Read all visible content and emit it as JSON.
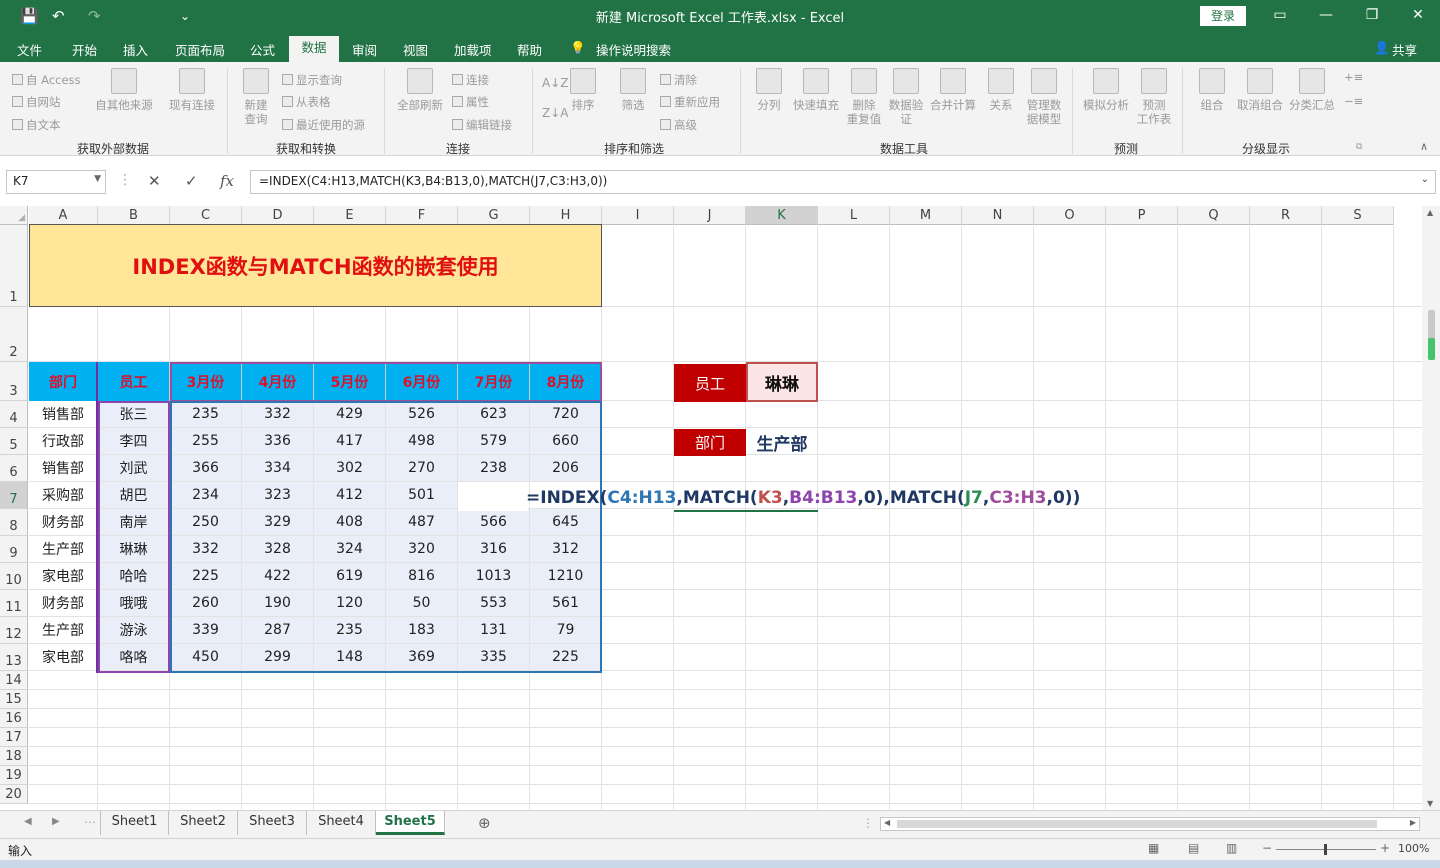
{
  "window": {
    "title": "新建 Microsoft Excel 工作表.xlsx  -  Excel",
    "login": "登录"
  },
  "qat": {
    "save": "💾",
    "undo": "↶",
    "redo": "↷",
    "more": "⌄"
  },
  "ribbon_tabs": [
    "文件",
    "开始",
    "插入",
    "页面布局",
    "公式",
    "数据",
    "审阅",
    "视图",
    "加载项",
    "帮助",
    "操作说明搜索"
  ],
  "share": "共享",
  "ribbon": {
    "ext": {
      "access": "自 Access",
      "web": "自网站",
      "text": "自文本",
      "other": "自其他来源",
      "existing": "现有连接",
      "group": "获取外部数据"
    },
    "transform": {
      "newq": "新建\n查询",
      "show": "显示查询",
      "table": "从表格",
      "recent": "最近使用的源",
      "group": "获取和转换"
    },
    "conn": {
      "refresh": "全部刷新",
      "connections": "连接",
      "props": "属性",
      "edit": "编辑链接",
      "group": "连接"
    },
    "sort": {
      "sort": "排序",
      "filter": "筛选",
      "clear": "清除",
      "reapply": "重新应用",
      "adv": "高级",
      "group": "排序和筛选"
    },
    "tools": {
      "split": "分列",
      "flash": "快速填充",
      "dup": "删除\n重复值",
      "valid": "数据验\n证",
      "cons": "合并计算",
      "rel": "关系",
      "model": "管理数\n据模型",
      "group": "数据工具"
    },
    "forecast": {
      "whatif": "模拟分析",
      "sheet": "预测\n工作表",
      "group": "预测"
    },
    "outline": {
      "grp": "组合",
      "ungrp": "取消组合",
      "sub": "分类汇总",
      "group": "分级显示"
    }
  },
  "namebox": "K7",
  "formula_bar": "=INDEX(C4:H13,MATCH(K3,B4:B13,0),MATCH(J7,C3:H3,0))",
  "columns": [
    "A",
    "B",
    "C",
    "D",
    "E",
    "F",
    "G",
    "H",
    "I",
    "J",
    "K",
    "L",
    "M",
    "N",
    "O",
    "P",
    "Q",
    "R",
    "S"
  ],
  "rows": [
    "1",
    "2",
    "3",
    "4",
    "5",
    "6",
    "7",
    "8",
    "9",
    "10",
    "11",
    "12",
    "13",
    "14",
    "15",
    "16",
    "17",
    "18",
    "19",
    "20"
  ],
  "sheet": {
    "title": "INDEX函数与MATCH函数的嵌套使用",
    "headers": [
      "部门",
      "员工",
      "3月份",
      "4月份",
      "5月份",
      "6月份",
      "7月份",
      "8月份"
    ],
    "data": [
      [
        "销售部",
        "张三",
        "235",
        "332",
        "429",
        "526",
        "623",
        "720"
      ],
      [
        "行政部",
        "李四",
        "255",
        "336",
        "417",
        "498",
        "579",
        "660"
      ],
      [
        "销售部",
        "刘武",
        "366",
        "334",
        "302",
        "270",
        "238",
        "206"
      ],
      [
        "采购部",
        "胡巴",
        "234",
        "323",
        "412",
        "501",
        "",
        ""
      ],
      [
        "财务部",
        "南岸",
        "250",
        "329",
        "408",
        "487",
        "566",
        "645"
      ],
      [
        "生产部",
        "琳琳",
        "332",
        "328",
        "324",
        "320",
        "316",
        "312"
      ],
      [
        "家电部",
        "哈哈",
        "225",
        "422",
        "619",
        "816",
        "1013",
        "1210"
      ],
      [
        "财务部",
        "哦哦",
        "260",
        "190",
        "120",
        "50",
        "553",
        "561"
      ],
      [
        "生产部",
        "游泳",
        "339",
        "287",
        "235",
        "183",
        "131",
        "79"
      ],
      [
        "家电部",
        "咯咯",
        "450",
        "299",
        "148",
        "369",
        "335",
        "225"
      ]
    ],
    "lookup": {
      "emp_label": "员工",
      "emp_value": "琳琳",
      "dept_label": "部门",
      "dept_value": "生产部"
    },
    "formula_parts": [
      "=INDEX(",
      "C4:H13",
      ",MATCH(",
      "K3",
      ",",
      "B4:B13",
      ",0),MATCH(",
      "J7",
      ",",
      "C3:H3",
      ",0))"
    ]
  },
  "sheets": [
    "Sheet1",
    "Sheet2",
    "Sheet3",
    "Sheet4",
    "Sheet5"
  ],
  "active_sheet": "Sheet5",
  "status": {
    "mode": "输入",
    "zoom": "100%"
  },
  "colors": {
    "accent": "#217346",
    "header_fill": "#00b0f0",
    "title_fill": "#ffe699",
    "lookup_fill": "#c00000"
  }
}
